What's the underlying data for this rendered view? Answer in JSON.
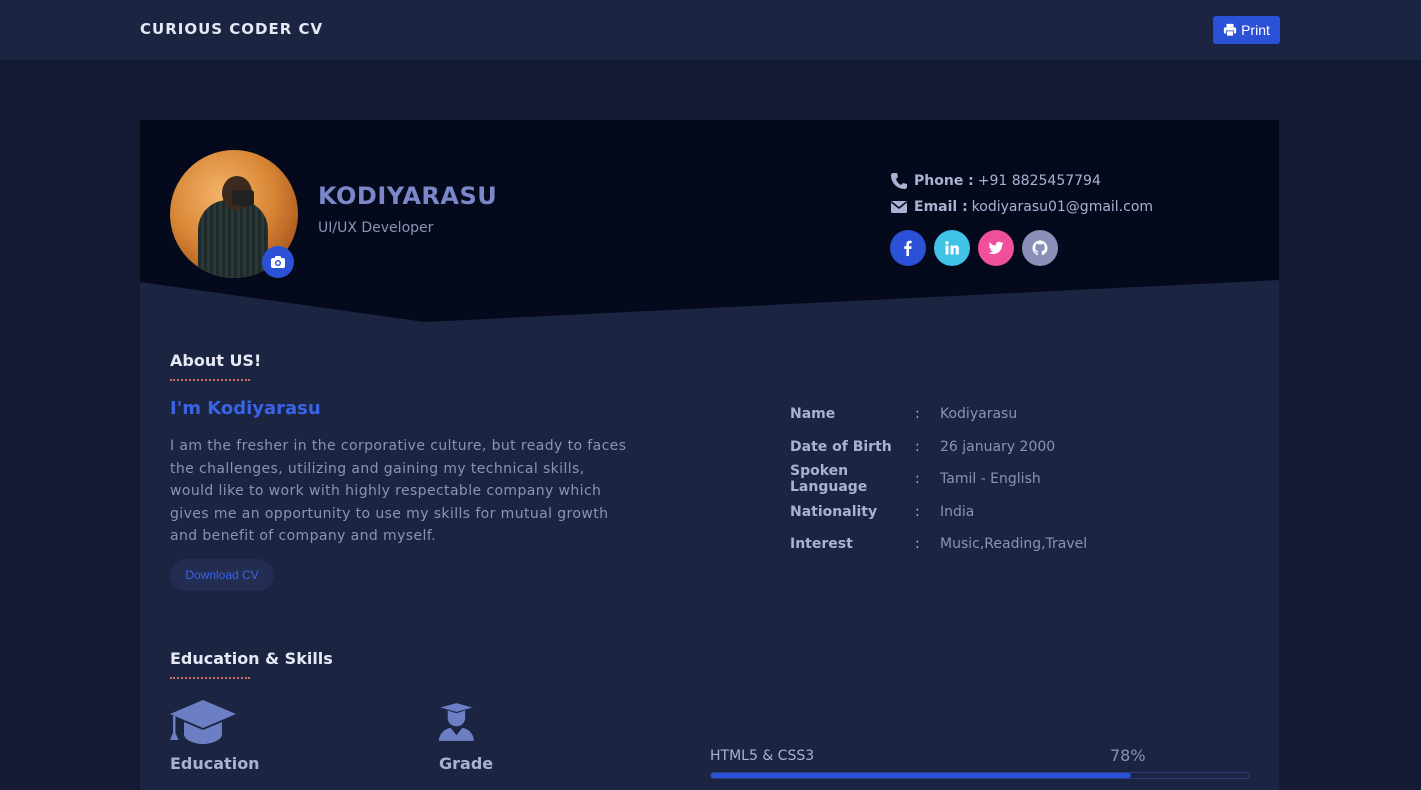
{
  "header": {
    "brand": "CURIOUS CODER CV",
    "print_label": "Print"
  },
  "profile": {
    "name": "KODIYARASU",
    "role": "UI/UX Developer",
    "phone_label": "Phone :",
    "phone": "+91 8825457794",
    "email_label": "Email :",
    "email": "kodiyarasu01@gmail.com",
    "socials": [
      {
        "name": "facebook",
        "icon": "facebook-icon",
        "color": "#2b51d6"
      },
      {
        "name": "linkedin",
        "icon": "linkedin-icon",
        "color": "#3fc2e6"
      },
      {
        "name": "twitter",
        "icon": "twitter-icon",
        "color": "#f0509a"
      },
      {
        "name": "github",
        "icon": "github-icon",
        "color": "#8a90b8"
      }
    ]
  },
  "about": {
    "title": "About US!",
    "heading": "I'm Kodiyarasu",
    "text": "I am the fresher in the corporative culture, but ready to faces the challenges, utilizing and gaining my technical skills, would like to work with highly respectable company which gives me an opportunity to use my skills for mutual growth and benefit of company and myself.",
    "download_label": "Download CV",
    "info": [
      {
        "key": "Name",
        "sep": ":",
        "value": "Kodiyarasu"
      },
      {
        "key": "Date of Birth",
        "sep": ":",
        "value": "26 january 2000"
      },
      {
        "key": "Spoken Language",
        "sep": ":",
        "value": "Tamil - English"
      },
      {
        "key": "Nationality",
        "sep": ":",
        "value": "India"
      },
      {
        "key": "Interest",
        "sep": ":",
        "value": "Music,Reading,Travel"
      }
    ]
  },
  "education": {
    "title": "Education & Skills",
    "education_label": "Education",
    "grade_label": "Grade",
    "skills": [
      {
        "name": "HTML5 & CSS3",
        "percent_label": "78%",
        "percent": 78
      }
    ]
  },
  "colors": {
    "accent": "#2b51d6",
    "hero": "#040a1c",
    "card": "#1b2440",
    "page": "#141a33"
  }
}
